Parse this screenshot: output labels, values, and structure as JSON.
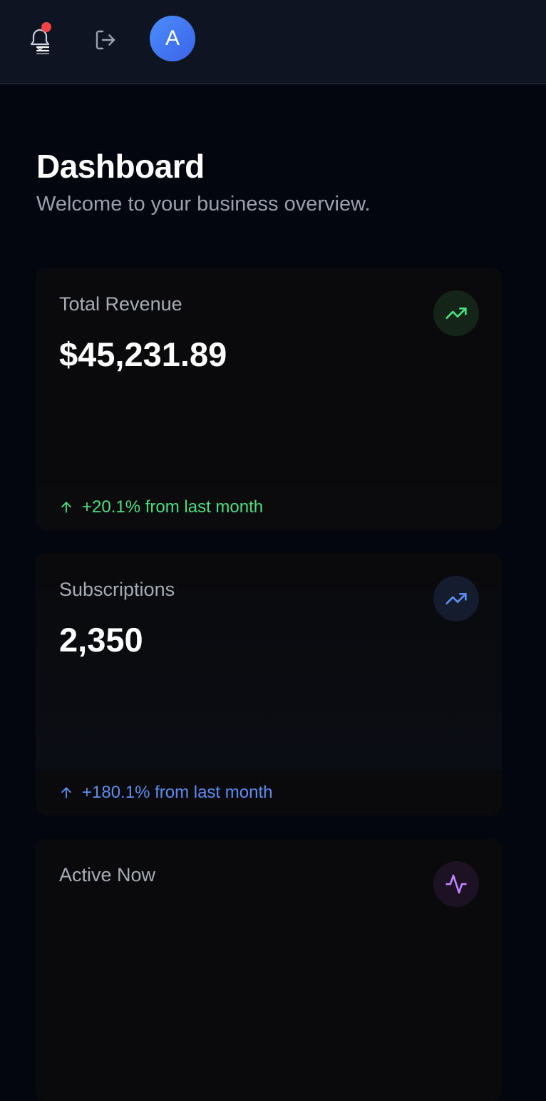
{
  "header": {
    "notification_icon": "bell-menu-icon",
    "logout_icon": "logout-icon",
    "avatar_initial": "A"
  },
  "page": {
    "title": "Dashboard",
    "subtitle": "Welcome to your business overview."
  },
  "cards": [
    {
      "label": "Total Revenue",
      "value": "$45,231.89",
      "icon": "trending-up-icon",
      "change": "+20.1% from last month",
      "accent": "#4ade80"
    },
    {
      "label": "Subscriptions",
      "value": "2,350",
      "icon": "trending-up-icon",
      "change": "+180.1% from last month",
      "accent": "#5b8def"
    },
    {
      "label": "Active Now",
      "icon": "activity-icon",
      "accent": "#c084fc"
    }
  ],
  "colors": {
    "background": "#03050f",
    "topbar": "#0f1422",
    "notification_dot": "#ef4444",
    "avatar": "#4c8dfb"
  }
}
